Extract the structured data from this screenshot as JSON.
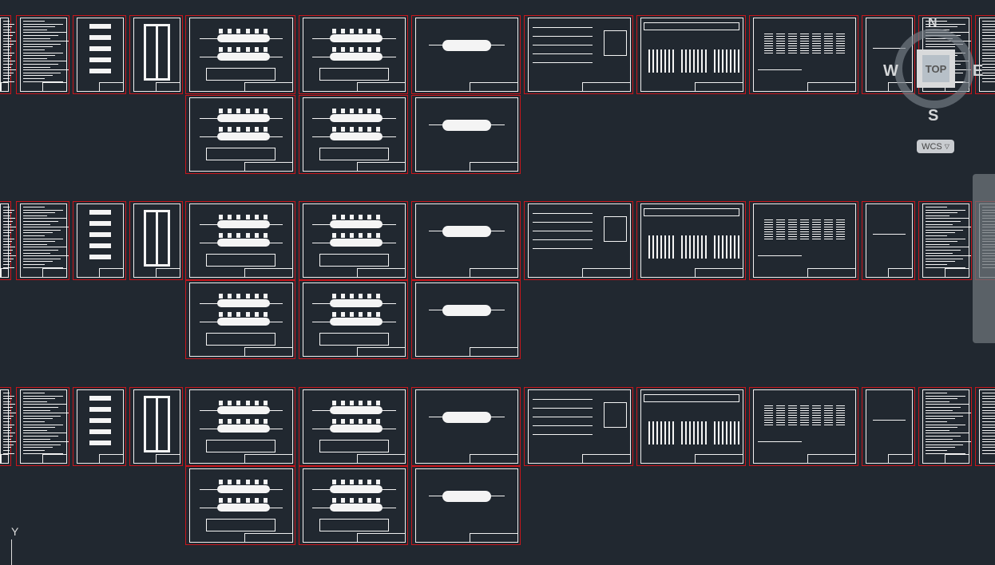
{
  "viewcube": {
    "north": "N",
    "south": "S",
    "east": "E",
    "west": "W",
    "face": "TOP"
  },
  "ucs_menu": {
    "label": "WCS",
    "icon": "chevron-down-icon"
  },
  "ucs_icon": {
    "axis_label": "Y"
  },
  "navigation_bar": {
    "tools": [
      "steering-wheel-icon",
      "pan-hand-icon",
      "zoom-icon",
      "orbit-icon",
      "showmotion-icon"
    ]
  },
  "colors": {
    "background": "#212830",
    "sheet_border": "#c8151b",
    "linework": "#f4f4f4"
  },
  "sheet_rows": [
    {
      "main": [
        "text",
        "text",
        "schematic",
        "floorplan",
        "piping",
        "piping",
        "vessel",
        "rack",
        "distribution",
        "panels",
        "blank",
        "text",
        "text"
      ],
      "sub": [
        "piping",
        "piping",
        "vessel"
      ]
    },
    {
      "main": [
        "text",
        "text",
        "schematic",
        "floorplan",
        "piping",
        "piping",
        "vessel",
        "rack",
        "distribution",
        "panels",
        "blank",
        "text",
        "text"
      ],
      "sub": [
        "piping",
        "piping",
        "vessel"
      ]
    },
    {
      "main": [
        "text",
        "text",
        "schematic",
        "floorplan",
        "piping",
        "piping",
        "vessel",
        "rack",
        "distribution",
        "panels",
        "blank",
        "text",
        "text"
      ],
      "sub": [
        "piping",
        "piping",
        "vessel"
      ]
    }
  ]
}
